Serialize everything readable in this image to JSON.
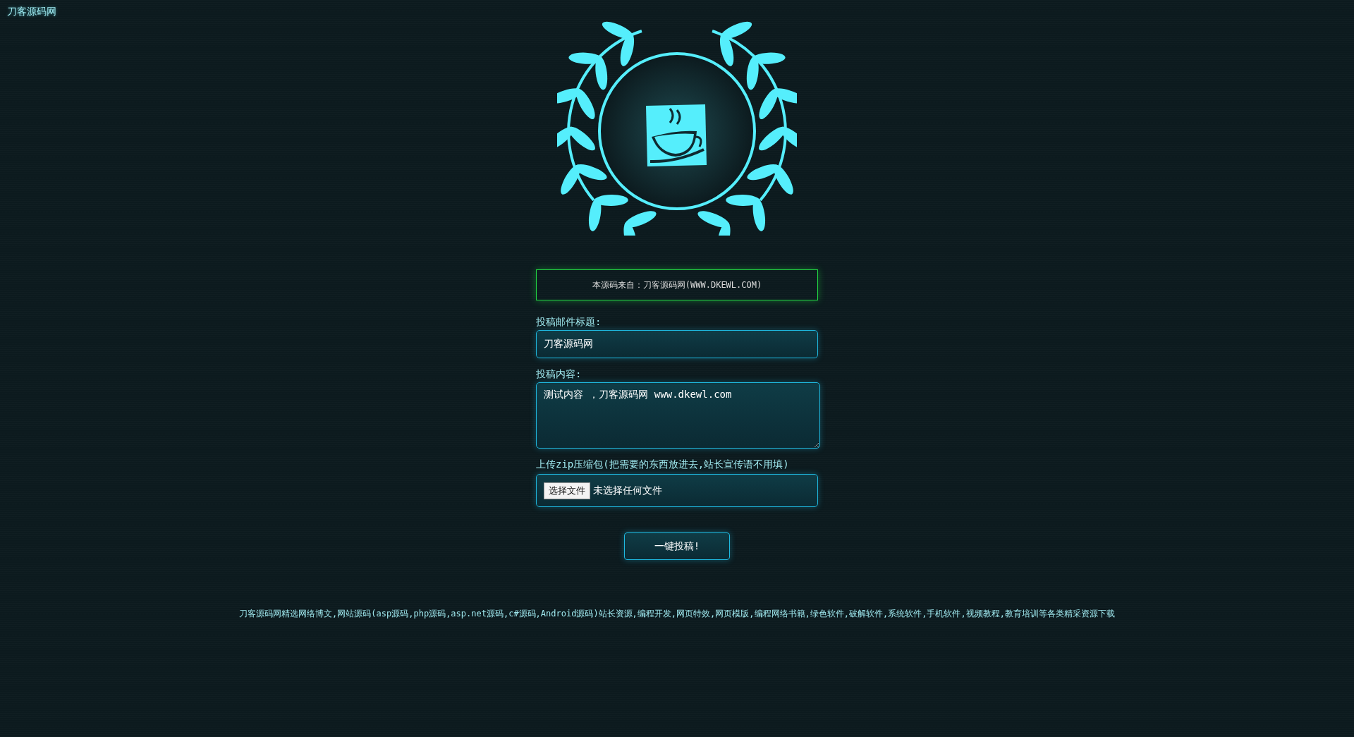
{
  "site_label": "刀客源码网",
  "notice": "本源码来自：刀客源码网(WWW.DKEWL.COM)",
  "fields": [
    {
      "kind": "input",
      "label": "投稿邮件标题:",
      "value": "刀客源码网"
    },
    {
      "kind": "textarea",
      "label": "投稿内容:",
      "value": "测试内容 ，刀客源码网 www.dkewl.com"
    },
    {
      "kind": "file",
      "label": "上传zip压缩包(把需要的东西放进去,站长宣传语不用填)",
      "button": "选择文件",
      "status": "未选择任何文件"
    }
  ],
  "submit": "一键投稿!",
  "footer": "刀客源码网精选网络博文,网站源码(asp源码,php源码,asp.net源码,c#源码,Android源码)站长资源,编程开发,网页特效,网页模版,编程网络书籍,绿色软件,破解软件,系统软件,手机软件,视频教程,教育培训等各类精采资源下载"
}
